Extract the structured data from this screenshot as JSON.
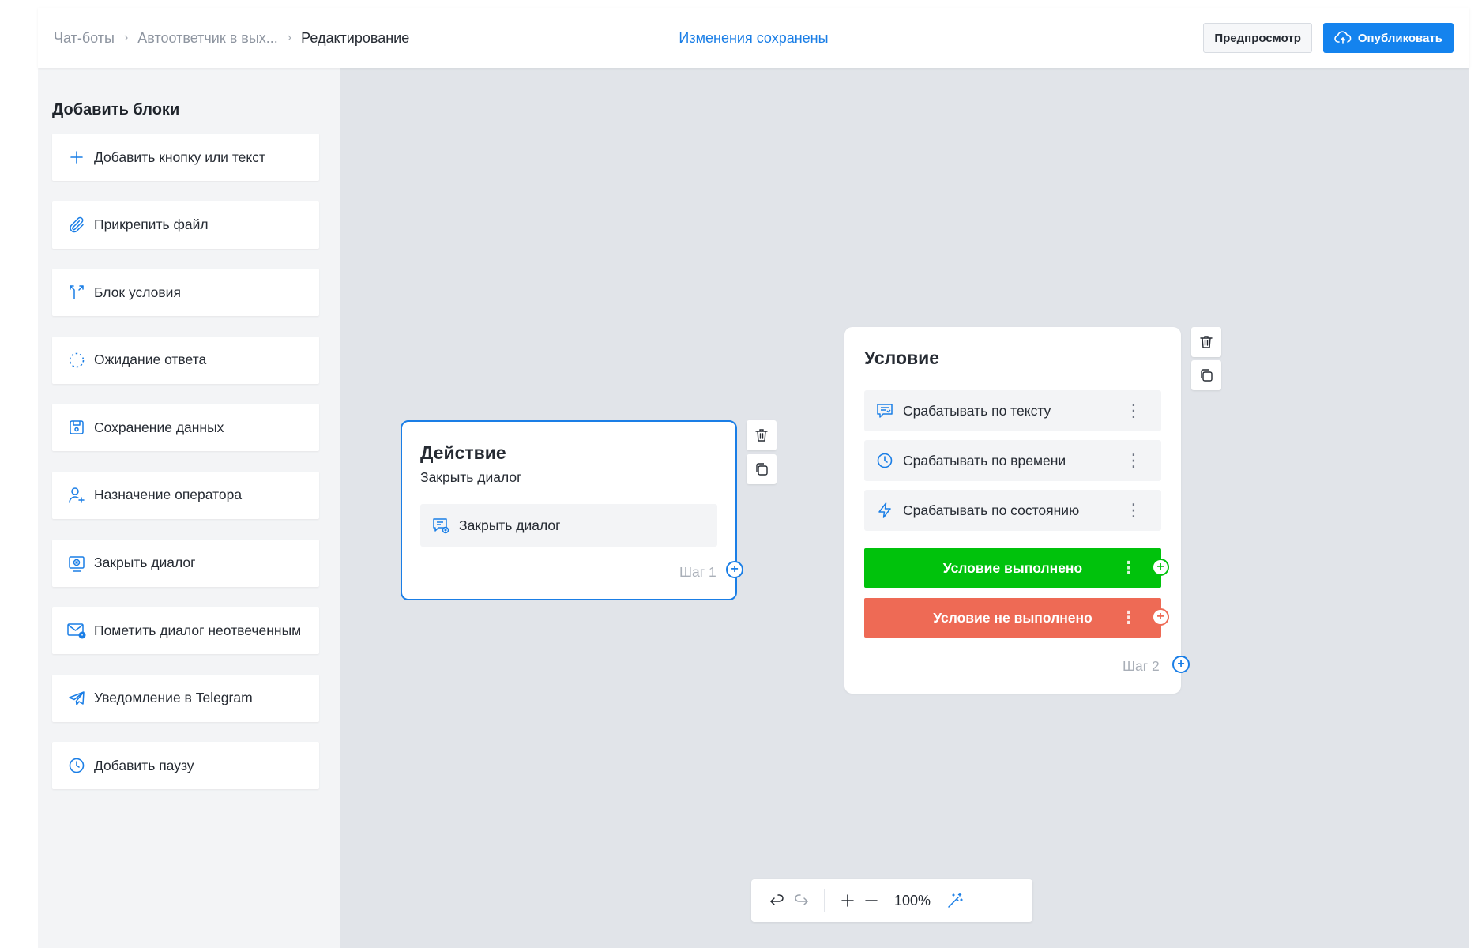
{
  "header": {
    "breadcrumb": [
      "Чат-боты",
      "Автоответчик в вых...",
      "Редактирование"
    ],
    "status": "Изменения сохранены",
    "preview_label": "Предпросмотр",
    "publish_label": "Опубликовать"
  },
  "sidebar": {
    "title": "Добавить блоки",
    "items": [
      {
        "label": "Добавить кнопку или текст",
        "icon": "plus-icon"
      },
      {
        "label": "Прикрепить файл",
        "icon": "paperclip-icon"
      },
      {
        "label": "Блок условия",
        "icon": "branch-icon"
      },
      {
        "label": "Ожидание ответа",
        "icon": "dashed-circle-icon"
      },
      {
        "label": "Сохранение данных",
        "icon": "save-icon"
      },
      {
        "label": "Назначение оператора",
        "icon": "add-user-icon"
      },
      {
        "label": "Закрыть диалог",
        "icon": "close-dialog-icon"
      },
      {
        "label": "Пометить диалог неотвеченным",
        "icon": "mail-alert-icon"
      },
      {
        "label": "Уведомление в Telegram",
        "icon": "telegram-icon"
      },
      {
        "label": "Добавить паузу",
        "icon": "clock-icon"
      }
    ]
  },
  "action_node": {
    "title": "Действие",
    "subtitle": "Закрыть диалог",
    "row_label": "Закрыть диалог",
    "step": "Шаг 1"
  },
  "condition_node": {
    "title": "Условие",
    "rows": [
      {
        "label": "Срабатывать по тексту",
        "icon": "chat-check-icon"
      },
      {
        "label": "Срабатывать по времени",
        "icon": "clock-icon"
      },
      {
        "label": "Срабатывать по состоянию",
        "icon": "lightning-icon"
      }
    ],
    "success_label": "Условие выполнено",
    "fail_label": "Условие не выполнено",
    "step": "Шаг 2"
  },
  "toolbar": {
    "zoom": "100%"
  },
  "colors": {
    "accent": "#1a7ee6",
    "success": "#00c20c",
    "fail": "#ee6a55",
    "canvas": "#e1e4e9"
  }
}
